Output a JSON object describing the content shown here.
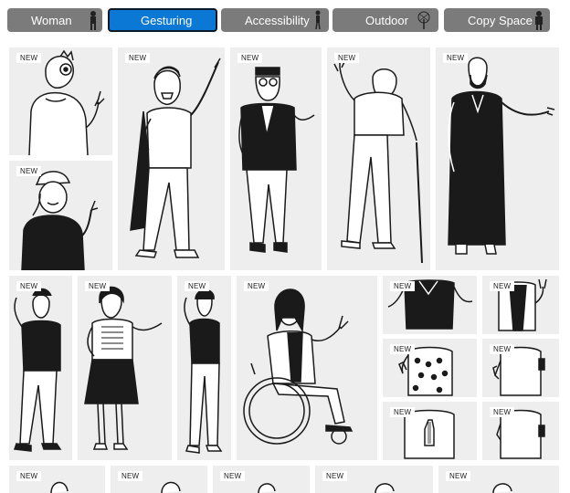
{
  "tabs": [
    {
      "label": "Woman",
      "active": false
    },
    {
      "label": "Gesturing",
      "active": true
    },
    {
      "label": "Accessibility",
      "active": false
    },
    {
      "label": "Outdoor",
      "active": false
    },
    {
      "label": "Copy Space",
      "active": false
    }
  ],
  "badge_label": "NEW",
  "cards": [
    {
      "subject": "cartoon person pointing up"
    },
    {
      "subject": "woman in cap pointing"
    },
    {
      "subject": "man in cape pointing up"
    },
    {
      "subject": "man in kufi gesturing"
    },
    {
      "subject": "older man with cane waving"
    },
    {
      "subject": "man in thobe presenting"
    },
    {
      "subject": "man on phone waving"
    },
    {
      "subject": "woman in skirt shrugging"
    },
    {
      "subject": "woman on phone waving"
    },
    {
      "subject": "woman in wheelchair waving"
    },
    {
      "subject": "hands open shrug"
    },
    {
      "subject": "peace sign gesture"
    },
    {
      "subject": "thumbs up polka dot shirt"
    },
    {
      "subject": "thumbs up with armband"
    },
    {
      "subject": "hands pressed together"
    },
    {
      "subject": "fist raised"
    },
    {
      "subject": "partial bottom row 1"
    },
    {
      "subject": "partial bottom row 2"
    },
    {
      "subject": "partial bottom row 3"
    },
    {
      "subject": "partial bottom row 4"
    },
    {
      "subject": "partial bottom row 5"
    }
  ],
  "colors": {
    "tab_bg": "#7b7b7b",
    "tab_active": "#0a78d4",
    "card_bg": "#eeeeee",
    "ink": "#1a1a1a"
  }
}
